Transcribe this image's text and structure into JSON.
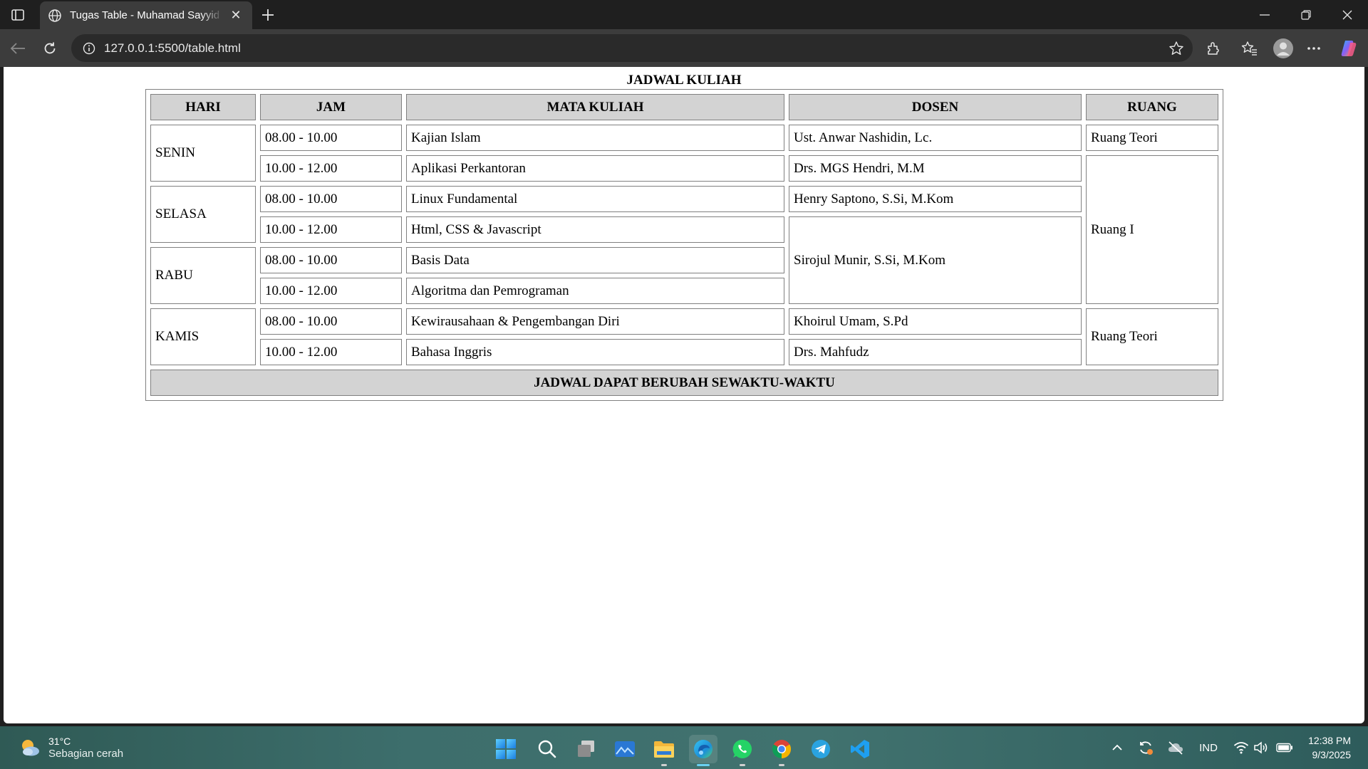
{
  "browser": {
    "tab_title": "Tugas Table - Muhamad Sayyid Fajar",
    "url": "127.0.0.1:5500/table.html"
  },
  "page": {
    "heading": "JADWAL KULIAH",
    "headers": [
      "HARI",
      "JAM",
      "MATA KULIAH",
      "DOSEN",
      "RUANG"
    ],
    "days": [
      "SENIN",
      "SELASA",
      "RABU",
      "KAMIS"
    ],
    "slots": [
      "08.00 - 10.00",
      "10.00 - 12.00"
    ],
    "courses": [
      "Kajian Islam",
      "Aplikasi Perkantoran",
      "Linux Fundamental",
      "Html, CSS & Javascript",
      "Basis Data",
      "Algoritma dan Pemrograman",
      "Kewirausahaan & Pengembangan Diri",
      "Bahasa Inggris"
    ],
    "lecturers": [
      "Ust. Anwar Nashidin, Lc.",
      "Drs. MGS Hendri, M.M",
      "Henry Saptono, S.Si, M.Kom",
      "Sirojul Munir, S.Si, M.Kom",
      "Khoirul Umam, S.Pd",
      "Drs. Mahfudz"
    ],
    "rooms": [
      "Ruang Teori",
      "Ruang I",
      "Ruang Teori"
    ],
    "footer": "JADWAL DAPAT BERUBAH SEWAKTU-WAKTU"
  },
  "taskbar": {
    "weather_temp": "31°C",
    "weather_desc": "Sebagian cerah",
    "language": "IND",
    "time": "12:38 PM",
    "date": "9/3/2025",
    "apps": [
      "start-icon",
      "search-icon",
      "task-view-icon",
      "photos-icon",
      "file-explorer-icon",
      "edge-icon",
      "whatsapp-icon",
      "chrome-icon",
      "telegram-icon",
      "vscode-icon"
    ]
  }
}
